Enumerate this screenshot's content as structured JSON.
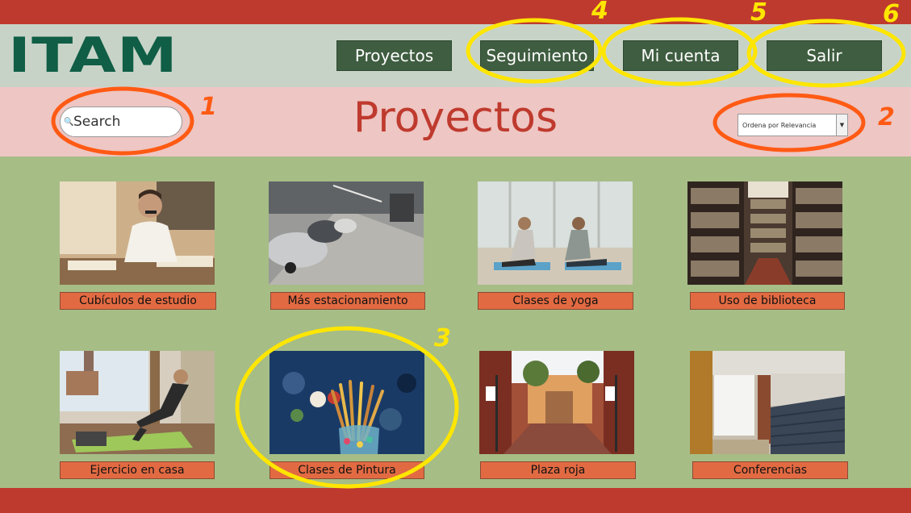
{
  "logo": {
    "text": "ITAM"
  },
  "nav": {
    "proyectos": "Proyectos",
    "seguimiento": "Seguimiento",
    "mi_cuenta": "Mi cuenta",
    "salir": "Salir"
  },
  "page_title": "Proyectos",
  "search": {
    "placeholder": "Search",
    "icon": "search-icon"
  },
  "sort": {
    "selected": "Ordena por Relevancia"
  },
  "cards": [
    {
      "label": "Cubículos de estudio"
    },
    {
      "label": "Más estacionamiento"
    },
    {
      "label": "Clases de yoga"
    },
    {
      "label": "Uso de biblioteca"
    },
    {
      "label": "Ejercicio en casa"
    },
    {
      "label": "Clases de Pintura"
    },
    {
      "label": "Plaza roja"
    },
    {
      "label": "Conferencias"
    }
  ],
  "annotations": [
    "1",
    "2",
    "3",
    "4",
    "5",
    "6"
  ],
  "colors": {
    "red_bar": "#bf3a2e",
    "header_bg": "#c8d3c8",
    "title_band": "#eec6c3",
    "body_green": "#a6bd86",
    "nav_button": "#3f5d40",
    "logo_green": "#0f5e45",
    "card_label": "#e26a42",
    "annotation_orange": "#ff5a14",
    "annotation_yellow": "#ffe600"
  }
}
